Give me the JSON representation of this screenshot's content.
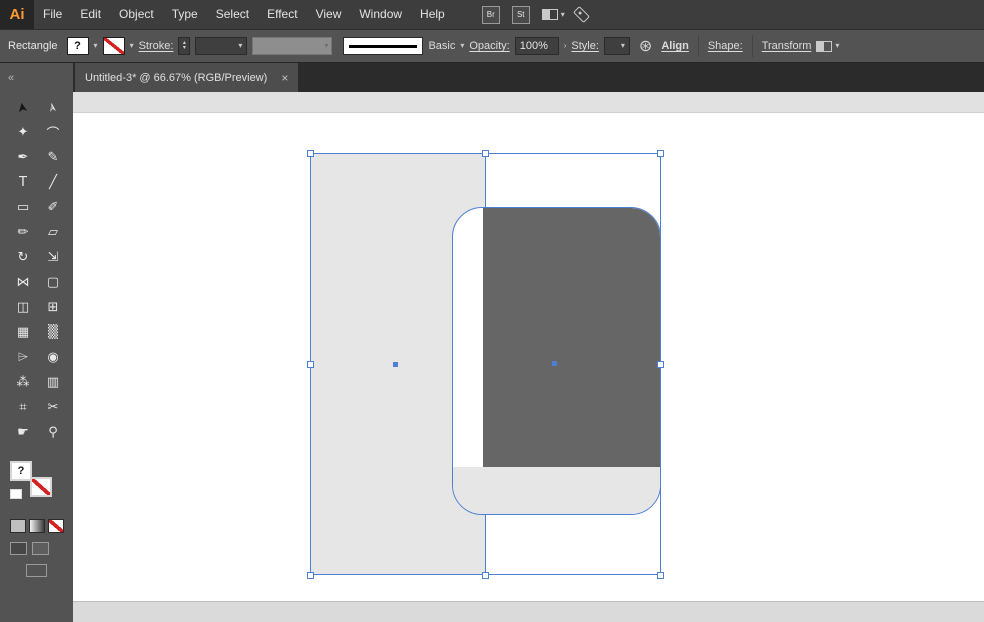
{
  "colors": {
    "accent_orange": "#ff9a2e",
    "selection_blue": "#4d7fd2",
    "shape_light_gray": "#e6e6e6",
    "shape_dark_gray": "#666666"
  },
  "icons": {
    "chevron_down": "▾",
    "chevron_right": "›",
    "spinner_up": "▴",
    "spinner_down": "▾",
    "close": "×",
    "collapse_left": "«",
    "recolor_wheel": "⊛"
  },
  "menubar": {
    "logo_label": "Ai",
    "items": [
      "File",
      "Edit",
      "Object",
      "Type",
      "Select",
      "Effect",
      "View",
      "Window",
      "Help"
    ],
    "bridge_button": "Br",
    "stock_button": "St"
  },
  "control_bar": {
    "context_label": "Rectangle",
    "fill_unknown_glyph": "?",
    "stroke_label": "Stroke:",
    "brush_name": "Basic",
    "opacity_label": "Opacity:",
    "opacity_value": "100%",
    "style_label": "Style:",
    "align_label": "Align",
    "shape_label": "Shape:",
    "transform_label": "Transform"
  },
  "document_tab": {
    "title": "Untitled-3* @ 66.67% (RGB/Preview)"
  },
  "toolbar": {
    "fill_glyph": "?",
    "tools": [
      {
        "name": "selection",
        "glyph": "➤"
      },
      {
        "name": "direct-selection",
        "glyph": "➢"
      },
      {
        "name": "magic-wand",
        "glyph": "✦"
      },
      {
        "name": "lasso",
        "glyph": "⌒"
      },
      {
        "name": "pen",
        "glyph": "✒"
      },
      {
        "name": "curvature",
        "glyph": "✎"
      },
      {
        "name": "type",
        "glyph": "T"
      },
      {
        "name": "line-segment",
        "glyph": "╱"
      },
      {
        "name": "rectangle",
        "glyph": "▭"
      },
      {
        "name": "paintbrush",
        "glyph": "✐"
      },
      {
        "name": "pencil",
        "glyph": "✏"
      },
      {
        "name": "eraser",
        "glyph": "▱"
      },
      {
        "name": "rotate",
        "glyph": "↻"
      },
      {
        "name": "scale",
        "glyph": "⇲"
      },
      {
        "name": "width",
        "glyph": "⋈"
      },
      {
        "name": "free-transform",
        "glyph": "▢"
      },
      {
        "name": "shape-builder",
        "glyph": "◫"
      },
      {
        "name": "perspective-grid",
        "glyph": "⊞"
      },
      {
        "name": "mesh",
        "glyph": "▦"
      },
      {
        "name": "gradient",
        "glyph": "▒"
      },
      {
        "name": "eyedropper",
        "glyph": "⌲"
      },
      {
        "name": "blend",
        "glyph": "◉"
      },
      {
        "name": "symbol-sprayer",
        "glyph": "⁂"
      },
      {
        "name": "column-graph",
        "glyph": "▥"
      },
      {
        "name": "artboard",
        "glyph": "⌗"
      },
      {
        "name": "slice",
        "glyph": "✂"
      },
      {
        "name": "hand",
        "glyph": "☛"
      },
      {
        "name": "zoom",
        "glyph": "⚲"
      }
    ]
  }
}
